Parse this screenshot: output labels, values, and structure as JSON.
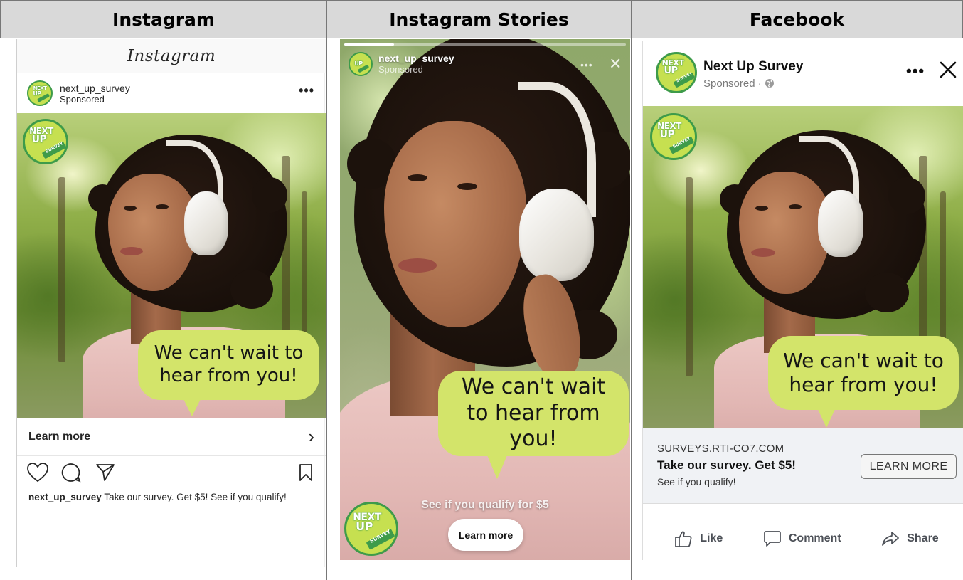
{
  "headers": {
    "col1": "Instagram",
    "col2": "Instagram Stories",
    "col3": "Facebook"
  },
  "ad_text": {
    "bubble": "We can't wait to hear from you!"
  },
  "logo": {
    "line1": "NEXT",
    "line2": "UP",
    "line3": "SURVEY"
  },
  "instagram": {
    "wordmark": "Instagram",
    "account_name": "next_up_survey",
    "sponsored": "Sponsored",
    "more": "•••",
    "cta": "Learn more",
    "cta_chevron": "›",
    "caption_user": "next_up_survey",
    "caption_text": " Take our survey. Get $5! See if you qualify!"
  },
  "stories": {
    "account_name": "next_up_survey",
    "sponsored": "Sponsored",
    "more": "•••",
    "close": "✕",
    "qualify_text": "See if you qualify for $5",
    "cta": "Learn more"
  },
  "facebook": {
    "page_name": "Next Up Survey",
    "sponsored": "Sponsored · ",
    "more": "•••",
    "domain": "SURVEYS.RTI-CO7.COM",
    "headline": "Take our survey. Get $5!",
    "description": "See if you qualify!",
    "cta": "LEARN MORE",
    "like": "Like",
    "comment": "Comment",
    "share": "Share"
  },
  "colors": {
    "bubble": "#d3e46a",
    "logo_green": "#3e9b4a",
    "logo_lime": "#c6e050",
    "header_gray": "#d9d9d9"
  }
}
